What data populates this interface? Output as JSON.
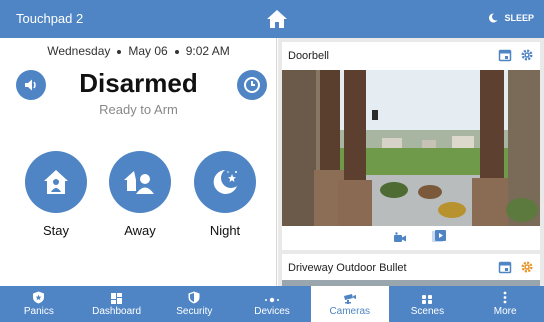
{
  "topbar": {
    "title": "Touchpad 2",
    "sleep_label": "SLEEP"
  },
  "left": {
    "weekday": "Wednesday",
    "date": "May 06",
    "time": "9:02 AM",
    "status": "Disarmed",
    "substatus": "Ready to Arm",
    "modes": [
      {
        "label": "Stay",
        "icon": "stay-house-icon"
      },
      {
        "label": "Away",
        "icon": "away-house-person-icon"
      },
      {
        "label": "Night",
        "icon": "night-moon-star-icon"
      }
    ]
  },
  "cameras": [
    {
      "name": "Doorbell"
    },
    {
      "name": "Driveway Outdoor Bullet"
    }
  ],
  "nav": {
    "items": [
      {
        "label": "Panics",
        "icon": "shield-star-icon"
      },
      {
        "label": "Dashboard",
        "icon": "dashboard-grid-icon"
      },
      {
        "label": "Security",
        "icon": "security-shield-icon"
      },
      {
        "label": "Devices",
        "icon": "devices-icon"
      },
      {
        "label": "Cameras",
        "icon": "camera-icon"
      },
      {
        "label": "Scenes",
        "icon": "scenes-icon"
      },
      {
        "label": "More",
        "icon": "more-vertical-icon"
      }
    ],
    "active": "Cameras"
  },
  "colors": {
    "primary": "#4f85c4",
    "accent_orange": "#e8962b"
  }
}
